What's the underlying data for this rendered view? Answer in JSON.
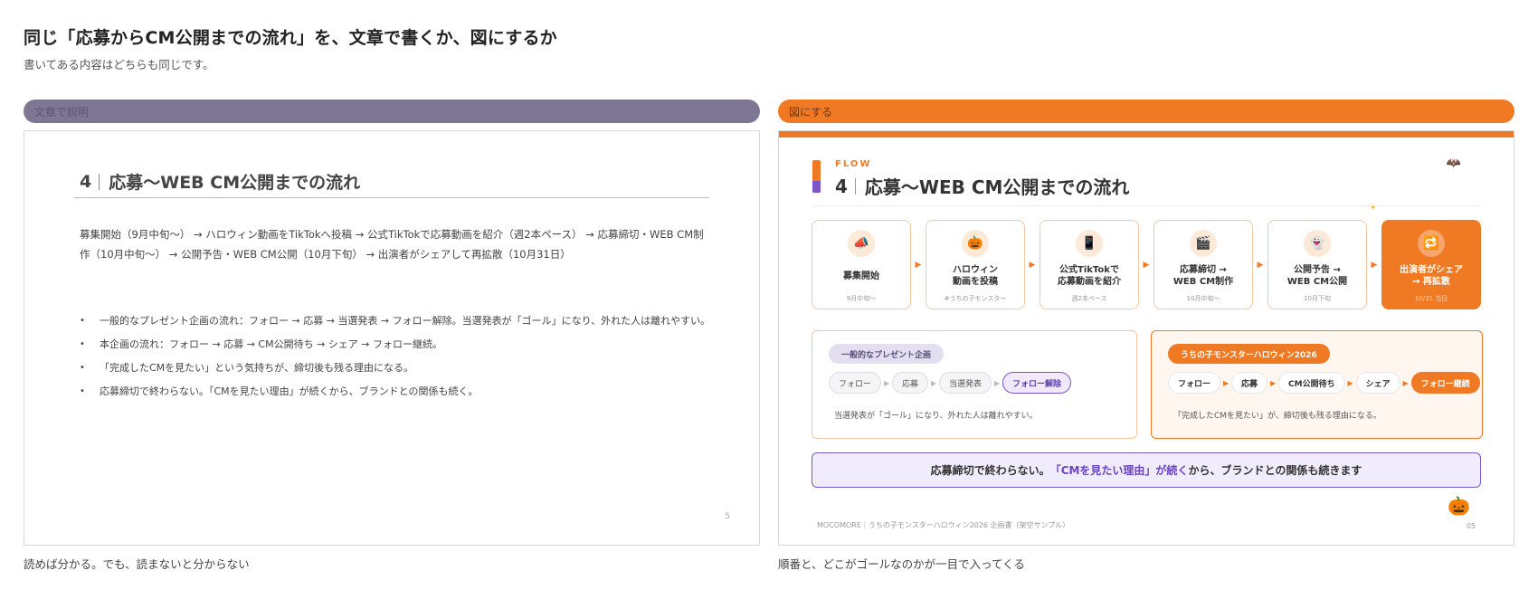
{
  "page": {
    "title": "同じ「応募からCM公開までの流れ」を、文章で書くか、図にするか",
    "subtitle": "書いてある内容はどちらも同じです。"
  },
  "left": {
    "pill": "文章で説明",
    "caption": "読めば分かる。でも、読まないと分からない",
    "slide": {
      "number": "4",
      "heading": "応募〜WEB CM公開までの流れ",
      "paragraph": "募集開始（9月中旬〜） → ハロウィン動画をTikTokへ投稿 → 公式TikTokで応募動画を紹介（週2本ペース） → 応募締切・WEB CM制作（10月中旬〜） → 公開予告・WEB CM公開（10月下旬） → 出演者がシェアして再拡散（10月31日）",
      "bullets": [
        "一般的なプレゼント企画の流れ：フォロー → 応募 → 当選発表 → フォロー解除。当選発表が「ゴール」になり、外れた人は離れやすい。",
        "本企画の流れ：フォロー → 応募 → CM公開待ち → シェア → フォロー継続。",
        "「完成したCMを見たい」という気持ちが、締切後も残る理由になる。",
        "応募締切で終わらない。「CMを見たい理由」が続くから、ブランドとの関係も続く。"
      ],
      "bullet_mark": "•",
      "page_number": "5"
    }
  },
  "right": {
    "pill": "図にする",
    "caption": "順番と、どこがゴールなのかが一目で入ってくる",
    "slide": {
      "kicker": "FLOW",
      "number": "4",
      "heading": "応募〜WEB CM公開までの流れ",
      "steps": [
        {
          "icon": "📣",
          "label": "募集開始",
          "note": "9月中旬〜"
        },
        {
          "icon": "🎃",
          "label": "ハロウィン\n動画を投稿",
          "note": "#うちの子モンスター"
        },
        {
          "icon": "📱",
          "label": "公式TikTokで\n応募動画を紹介",
          "note": "週2本ペース"
        },
        {
          "icon": "🎬",
          "label": "応募締切 →\nWEB CM制作",
          "note": "10月中旬〜"
        },
        {
          "icon": "👻",
          "label": "公開予告 →\nWEB CM公開",
          "note": "10月下旬"
        },
        {
          "icon": "🔁",
          "label": "出演者がシェア\n→ 再拡散",
          "note": "10/31 当日"
        }
      ],
      "general": {
        "tag": "一般的なプレゼント企画",
        "chips": [
          "フォロー",
          "応募",
          "当選発表",
          "フォロー解除"
        ],
        "note": "当選発表が「ゴール」になり、外れた人は離れやすい。"
      },
      "ours": {
        "tag": "うちの子モンスターハロウィン2026",
        "chips": [
          "フォロー",
          "応募",
          "CM公開待ち",
          "シェア",
          "フォロー継続"
        ],
        "note": "「完成したCMを見たい」が、締切後も残る理由になる。"
      },
      "banner": {
        "before": "応募締切で終わらない。",
        "highlight": "「CMを見たい理由」が続く",
        "after": "から、ブランドとの関係も続きます"
      },
      "footer": "MOCOMORE｜うちの子モンスターハロウィン2026 企画書（架空サンプル）",
      "page_number": "05",
      "colors": {
        "accent_orange": "#f07a23",
        "accent_purple": "#7c55c6",
        "left_pill": "#7e7692"
      }
    }
  }
}
